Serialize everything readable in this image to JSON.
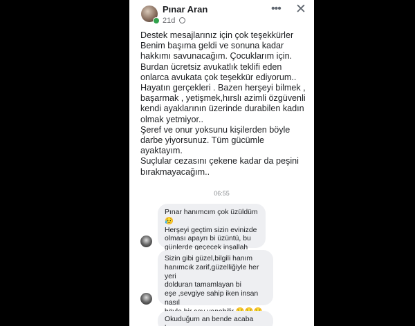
{
  "post": {
    "author": "Pınar Aran",
    "time": "21d",
    "more_icon": "•••",
    "close_icon": "✕",
    "text": "Destek mesajlarınız için çok teşekkürler\nBenim başıma geldi ve sonuna kadar\nhakkımı savunacağım. Çocuklarım için.\nBurdan ücretsiz avukatlık teklifi eden\nonlarca avukata çok teşekkür ediyorum..\nHayatın gerçekleri . Bazen herşeyi bilmek ,\nbaşarmak , yetişmek,hırslı azimli özgüvenli\nkendi ayaklarının üzerinde durabilen kadın\nolmak yetmiyor..\nŞeref ve onur yoksunu kişilerden böyle\ndarbe yiyorsunuz. Tüm gücümle\nayaktayım.\nSuçlular cezasını çekene kadar da peşini\nbırakmayacağım.."
  },
  "chat": {
    "timestamp": "06:55",
    "messages": [
      {
        "text": "Pınar hanımcım çok üzüldüm 😥\nHerşeyi geçtim sizin evinizde\nolması apayrı bi üzüntü, bu\ngünlerde geçecek inşallah"
      },
      {
        "text": "Sizin gibi güzel,bilgili  hanım\nhanımcık zarif,güzelliğiyle her yeri\ndolduran tamamlayan bi\neşe ,sevgiye sahip iken insan nasıl\nböyle bir şey yapabilir 😣😣😣😡"
      },
      {
        "text": "Okuduğum an bende acaba hesap"
      }
    ]
  },
  "colors": {
    "bubble": "#eeeff2",
    "online": "#31a24c",
    "secondary_text": "#65676b"
  }
}
